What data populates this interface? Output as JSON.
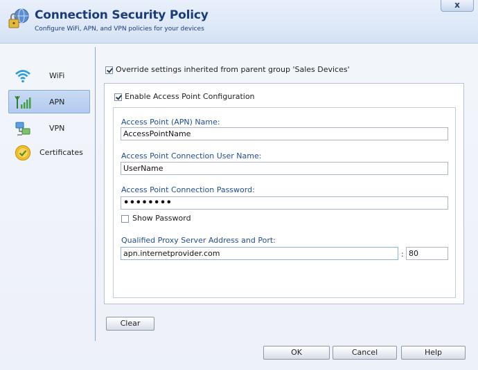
{
  "header": {
    "title": "Connection Security Policy",
    "subtitle": "Configure WiFi, APN, and VPN policies for your devices",
    "close_label": "x"
  },
  "nav": {
    "active": "APN",
    "items": [
      {
        "label": "WiFi",
        "icon": "wifi-icon"
      },
      {
        "label": "APN",
        "icon": "signal-bars-icon"
      },
      {
        "label": "VPN",
        "icon": "vpn-icon"
      },
      {
        "label": "Certificates",
        "icon": "certificate-icon"
      }
    ]
  },
  "override": {
    "label": "Override settings inherited from parent group 'Sales Devices'",
    "checked": true
  },
  "enable": {
    "label": "Enable Access Point Configuration",
    "checked": true
  },
  "form": {
    "apn_name_label": "Access Point (APN) Name:",
    "apn_name_value": "AccessPointName",
    "user_label": "Access Point Connection User Name:",
    "user_value": "UserName",
    "password_label": "Access Point Connection Password:",
    "password_value": "••••••••",
    "show_password_label": "Show Password",
    "show_password_checked": false,
    "proxy_label": "Qualified Proxy Server Address and Port:",
    "proxy_value": "apn.internetprovider.com",
    "port_separator": ":",
    "port_value": "80"
  },
  "buttons": {
    "clear": "Clear",
    "ok": "OK",
    "cancel": "Cancel",
    "help": "Help"
  },
  "colors": {
    "title": "#1b3b7a",
    "field_label": "#1f4d99",
    "nav_active_bg": "#b3cbee"
  }
}
